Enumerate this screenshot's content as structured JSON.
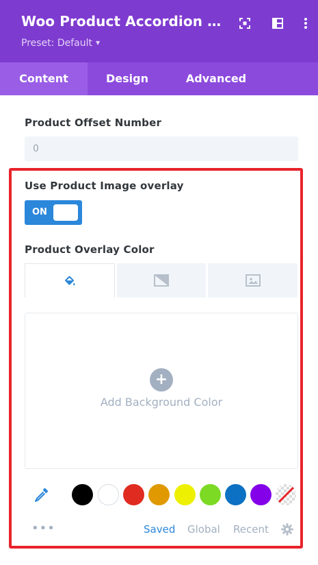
{
  "header": {
    "title": "Woo Product Accordion Settings",
    "preset": "Preset: Default",
    "background": "#7e3bd0"
  },
  "tabs": [
    {
      "label": "Content",
      "active": true
    },
    {
      "label": "Design",
      "active": false
    },
    {
      "label": "Advanced",
      "active": false
    }
  ],
  "fields": {
    "offset": {
      "label": "Product Offset Number",
      "value": "0"
    },
    "overlay_toggle": {
      "label": "Use Product Image overlay",
      "state": "ON"
    },
    "overlay_color": {
      "label": "Product Overlay Color"
    }
  },
  "color_panel": {
    "tab_icons": [
      "paint-bucket-icon",
      "gradient-icon",
      "image-icon"
    ],
    "add_label": "Add Background Color",
    "add_icon": "plus-icon",
    "swatches": [
      "#000000",
      "#ffffff",
      "#e02b20",
      "#e09900",
      "#edf000",
      "#7cda24",
      "#0c71c3",
      "#8300e9",
      "none"
    ],
    "bottom_tabs": [
      {
        "label": "Saved",
        "active": true
      },
      {
        "label": "Global",
        "active": false
      },
      {
        "label": "Recent",
        "active": false
      }
    ]
  },
  "colors": {
    "accent": "#2b87da",
    "highlight_border": "#e8232b"
  }
}
